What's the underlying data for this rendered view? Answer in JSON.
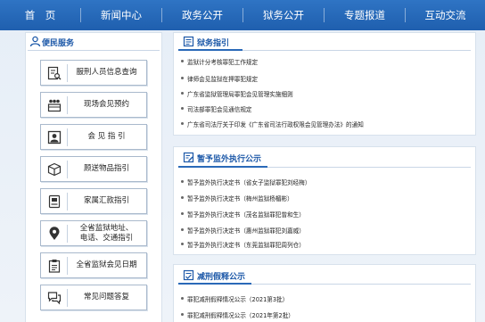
{
  "nav": {
    "items": [
      "首　页",
      "新闻中心",
      "政务公开",
      "狱务公开",
      "专题报道",
      "互动交流"
    ]
  },
  "sidebar": {
    "title": "便民服务",
    "items": [
      {
        "label": "服刑人员信息查询",
        "icon": "person-search-icon"
      },
      {
        "label": "现场会见预约",
        "icon": "people-calendar-icon"
      },
      {
        "label": "会 见 指 引",
        "icon": "portrait-icon"
      },
      {
        "label": "顾送物品指引",
        "icon": "package-icon"
      },
      {
        "label": "家属汇款指引",
        "icon": "bank-card-icon"
      },
      {
        "label": "全省监狱地址、\n电话、交通指引",
        "icon": "location-pin-icon"
      },
      {
        "label": "全省监狱会见日期",
        "icon": "clipboard-icon"
      },
      {
        "label": "常见问题答复",
        "icon": "chat-bubbles-icon"
      }
    ]
  },
  "sections": [
    {
      "title": "狱务指引",
      "icon": "document-icon",
      "items": [
        "监狱计分考核罪犯工作规定",
        "律师会见监狱在押罪犯规定",
        "广东省监狱管理局罪犯会见管理实施细则",
        "司法部罪犯会见通信规定",
        "广东省司法厅关于印发《广东省司法行政权限会见管理办法》的通知"
      ]
    },
    {
      "title": "暂予监外执行公示",
      "icon": "document-edit-icon",
      "items": [
        "暂予监外执行决定书（省女子监狱罪犯刘经梅）",
        "暂予监外执行决定书（梅州监狱杨楣彬）",
        "暂予监外执行决定书（茂名监狱罪犯曾和生）",
        "暂予监外执行决定书（惠州监狱罪犯刘嘉威）",
        "暂予监外执行决定书（东莞监狱罪犯周列仓）"
      ]
    },
    {
      "title": "减刑假释公示",
      "icon": "document-check-icon",
      "items": [
        "罪犯减刑假释情况公示（2021第3批）",
        "罪犯减刑假释情况公示（2021年第2批）"
      ]
    }
  ],
  "colors": {
    "nav": "#1f5fae",
    "accent": "#1c58a8"
  }
}
